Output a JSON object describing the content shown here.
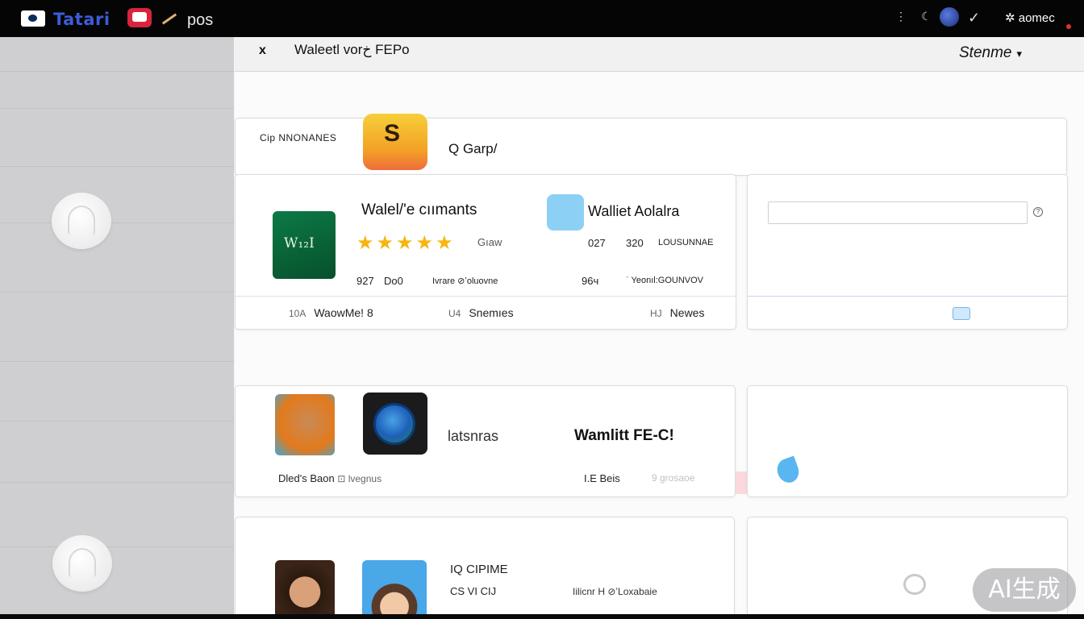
{
  "topbar": {
    "title": "Tatari",
    "app_label": "pos",
    "tray": [
      "⋮",
      "☾",
      "✓"
    ],
    "user": "✲ aomec"
  },
  "window": {
    "close": "x",
    "title": "Waleetl vorخ FEPo",
    "right_label": "Stenme",
    "right_arrow": "▾"
  },
  "search": {
    "category_label": "Cip NNONANES",
    "coin_symbol": "S",
    "query": "Q Garp/"
  },
  "featured": {
    "name": "Walel/'e cıımants",
    "stars": "★★★★★",
    "rating_label": "Gıaw",
    "icon_text": "W₁₂I",
    "name2": "Walliet Aolalra",
    "stats_left": [
      "927",
      "Do0",
      "Ivrare ⊘ʼoluovne"
    ],
    "stats_right": [
      "027",
      "320",
      "LOUSUNNAE"
    ],
    "stats_right2": [
      "96ч",
      "ˈ Yeonıl:GOUNVOV"
    ],
    "tabs": [
      {
        "num": "10A",
        "label": "WaowMe! 8"
      },
      {
        "num": "U4",
        "label": "Snemıes"
      },
      {
        "num": "HJ",
        "label": "Newes"
      }
    ]
  },
  "side1": {
    "input_value": "",
    "help": "?"
  },
  "row2": {
    "text1": "latsnras",
    "text2": "Wamlitt FE-C!",
    "foot_left": "Dled's Baon",
    "foot_left_tag": "⊡ lvegnus",
    "foot_right": "I.E  Beis",
    "foot_right_faint": "9 grosaoe"
  },
  "row3": {
    "t1": "IQ CIPIME",
    "t2": "CS VI   CIJ",
    "t3": "Iilicnr   H ⊘ʼLoxabaie"
  },
  "badge": "AI生成"
}
